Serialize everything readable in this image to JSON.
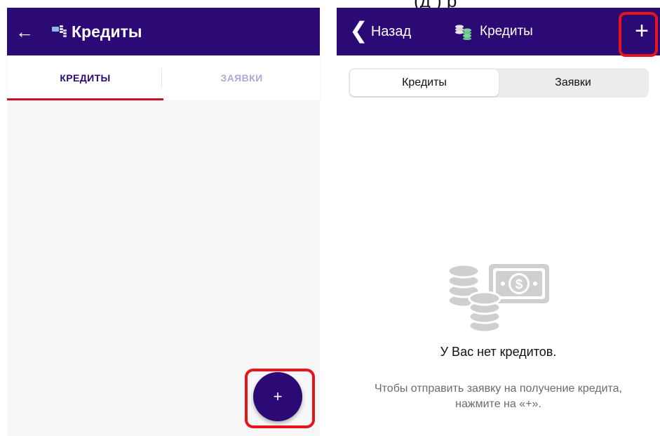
{
  "top_clip_text": "(д                         )                                  р",
  "android": {
    "back_glyph": "←",
    "title": "Кредиты",
    "tabs": [
      {
        "label": "КРЕДИТЫ",
        "active": true
      },
      {
        "label": "ЗАЯВКИ",
        "active": false
      }
    ],
    "fab_glyph": "+",
    "icon": "money-coins-icon",
    "colors": {
      "appbar": "#2c0a75",
      "tab_indicator": "#c8102e",
      "highlight": "#e8141b"
    }
  },
  "ios": {
    "back_label": "Назад",
    "back_glyph": "❮",
    "title": "Кредиты",
    "plus_glyph": "+",
    "segments": [
      {
        "label": "Кредиты",
        "active": true
      },
      {
        "label": "Заявки",
        "active": false
      }
    ],
    "empty_title": "У Вас нет кредитов.",
    "hint_line1": "Чтобы отправить заявку на получение кредита,",
    "hint_line2": "нажмите на «+».",
    "icon": "money-coins-icon",
    "colors": {
      "navbar": "#2c0a75",
      "illustration": "#cfcfcf",
      "highlight": "#e8141b"
    }
  }
}
